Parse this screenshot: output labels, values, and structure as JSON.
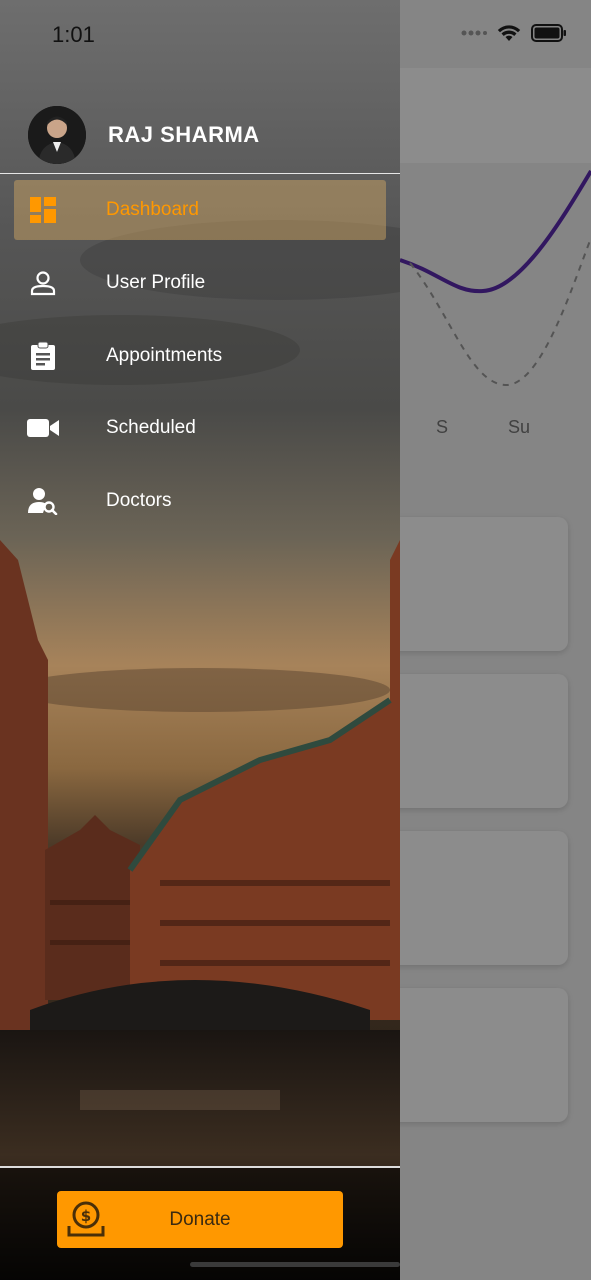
{
  "status_bar": {
    "time": "1:01"
  },
  "profile": {
    "name": "RAJ SHARMA"
  },
  "menu": {
    "items": [
      {
        "label": "Dashboard",
        "icon": "dashboard-icon",
        "active": true
      },
      {
        "label": "User Profile",
        "icon": "user-icon",
        "active": false
      },
      {
        "label": "Appointments",
        "icon": "clipboard-icon",
        "active": false
      },
      {
        "label": "Scheduled",
        "icon": "video-camera-icon",
        "active": false
      },
      {
        "label": "Doctors",
        "icon": "user-search-icon",
        "active": false
      }
    ]
  },
  "footer": {
    "donate_label": "Donate",
    "donate_icon": "dollar-bag-icon"
  },
  "background": {
    "chart_days": [
      "S",
      "Su"
    ]
  },
  "colors": {
    "accent": "#ff9800",
    "chart_line": "#5b2bb0"
  }
}
